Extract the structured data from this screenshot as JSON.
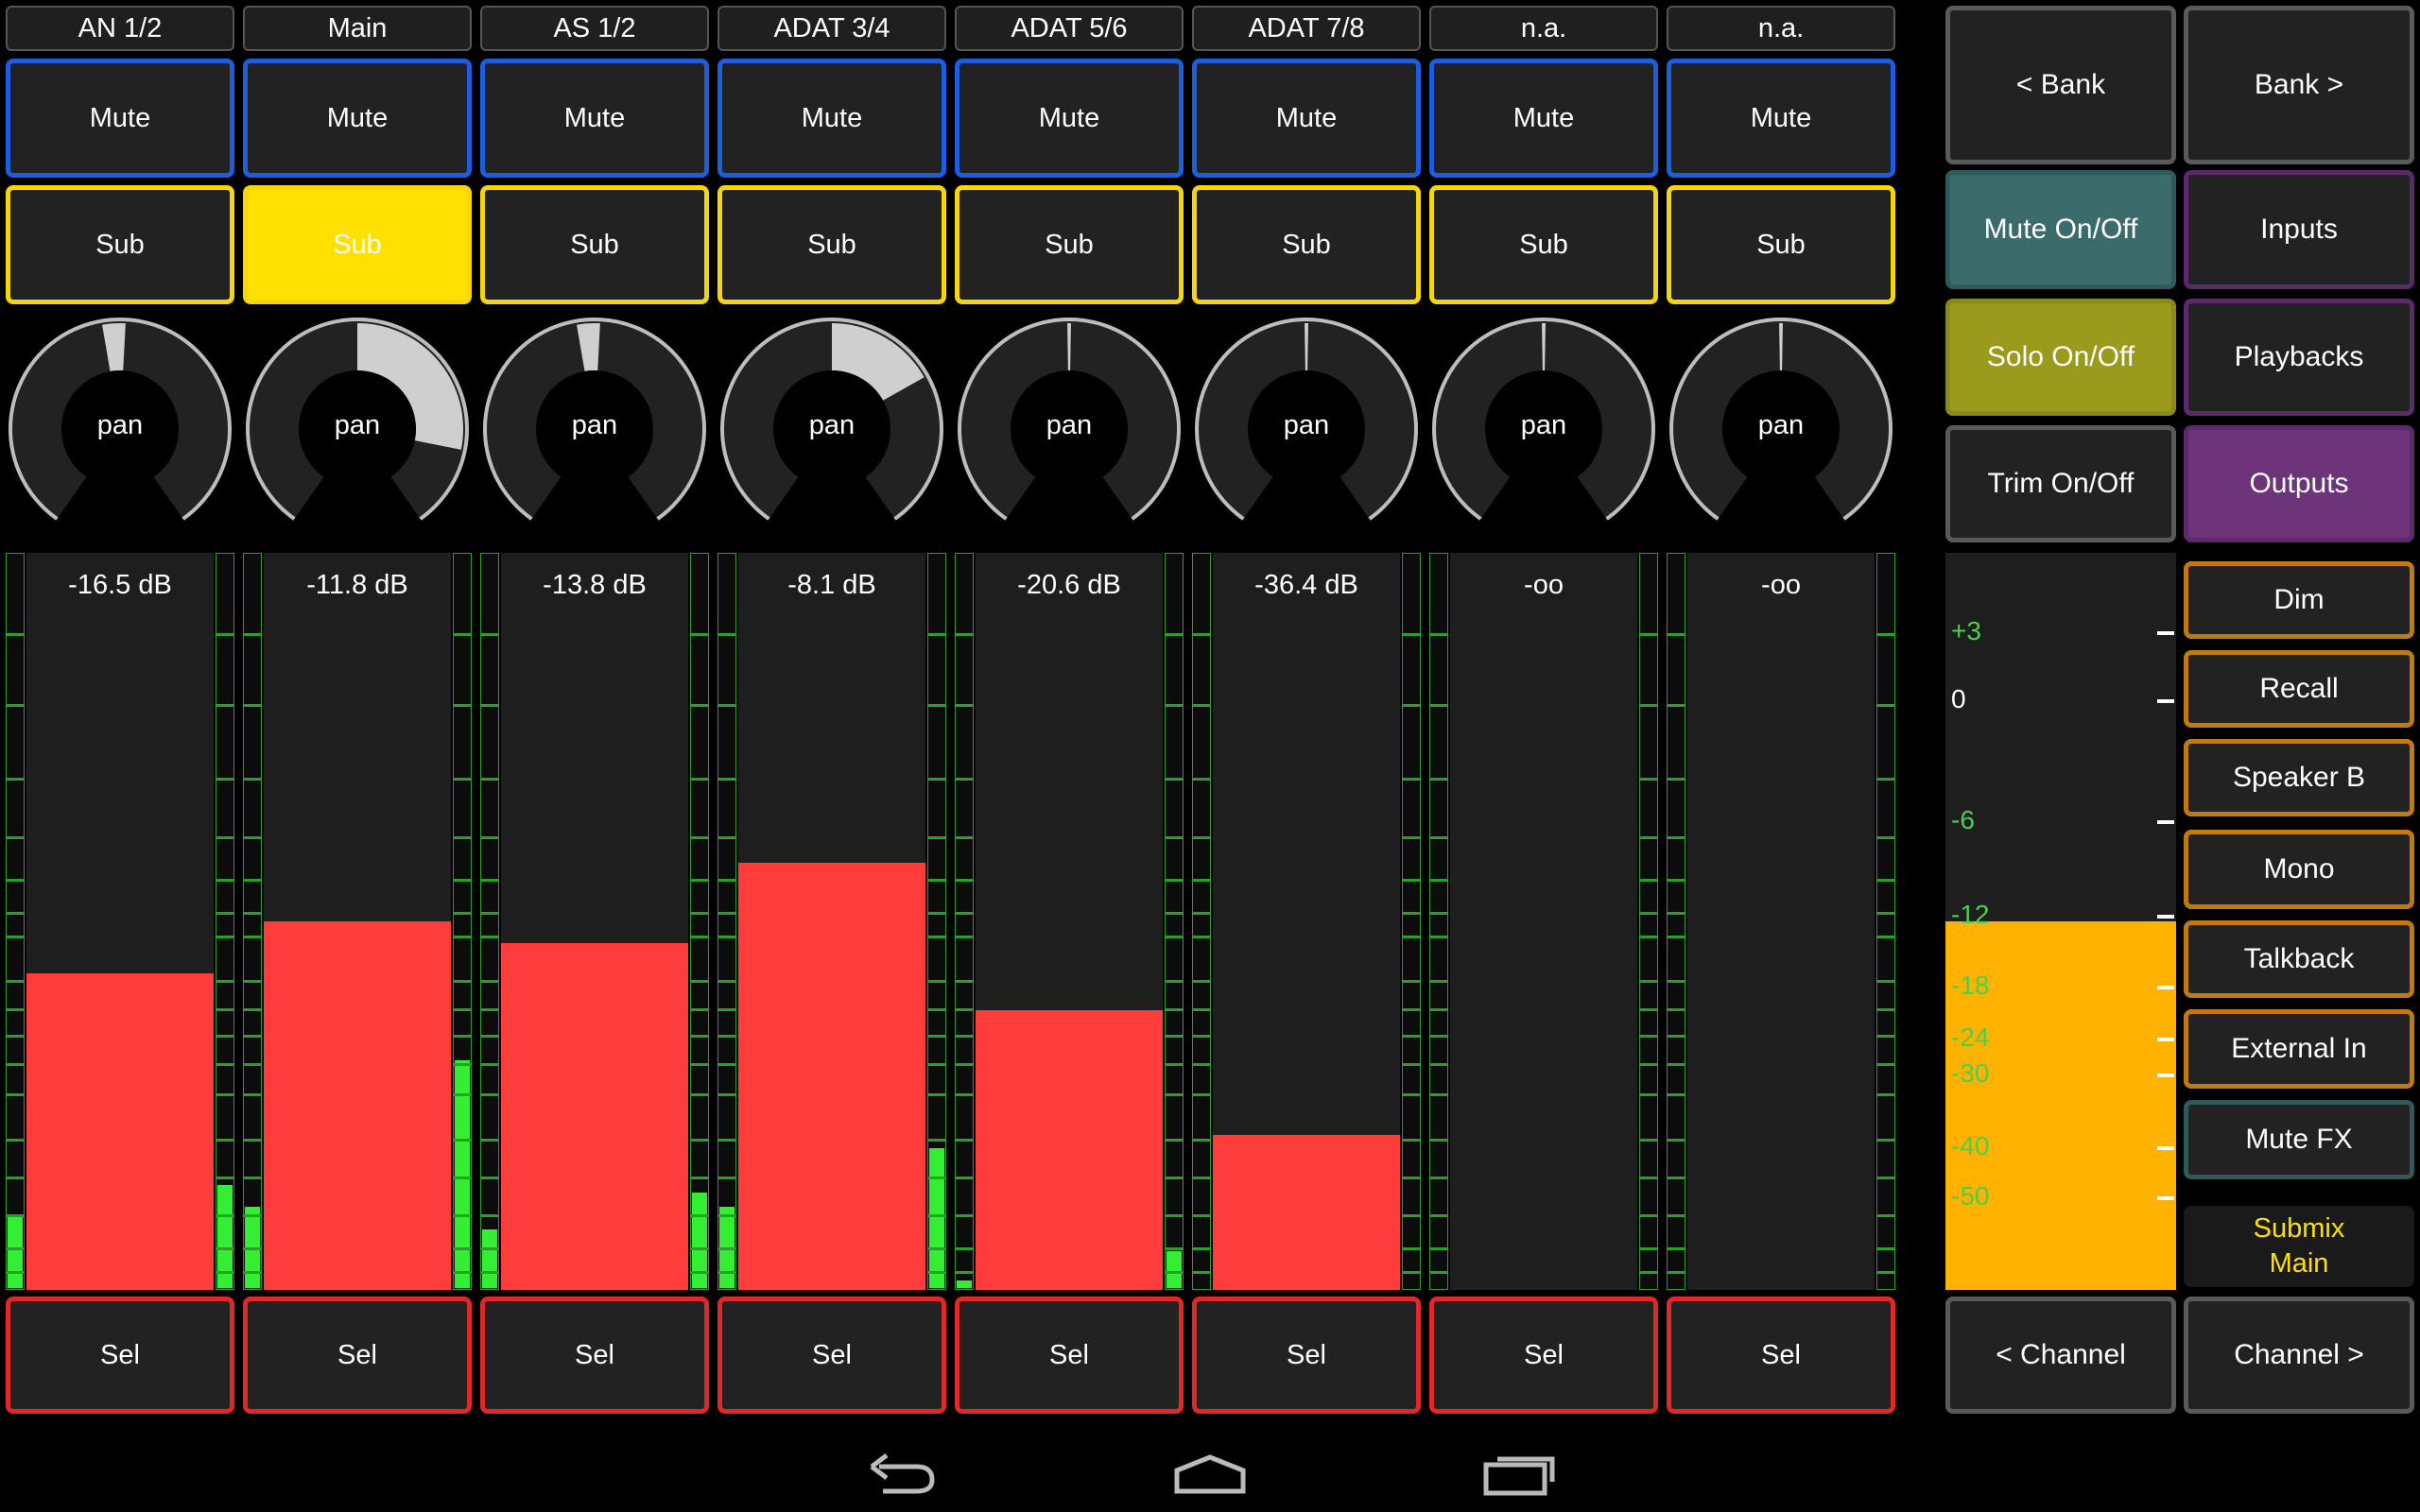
{
  "channels": [
    {
      "name": "AN 1/2",
      "mute": "Mute",
      "sub": "Sub",
      "sub_on": false,
      "pan_label": "pan",
      "pan": -0.05,
      "db": "-16.5 dB",
      "fader": 0.43,
      "lvl_l": 0.1,
      "lvl_r": 0.14,
      "sel": "Sel"
    },
    {
      "name": "Main",
      "mute": "Mute",
      "sub": "Sub",
      "sub_on": true,
      "pan_label": "pan",
      "pan": 0.75,
      "db": "-11.8 dB",
      "fader": 0.5,
      "lvl_l": 0.11,
      "lvl_r": 0.31,
      "sel": "Sel"
    },
    {
      "name": "AS 1/2",
      "mute": "Mute",
      "sub": "Sub",
      "sub_on": false,
      "pan_label": "pan",
      "pan": -0.05,
      "db": "-13.8 dB",
      "fader": 0.47,
      "lvl_l": 0.08,
      "lvl_r": 0.13,
      "sel": "Sel"
    },
    {
      "name": "ADAT 3/4",
      "mute": "Mute",
      "sub": "Sub",
      "sub_on": false,
      "pan_label": "pan",
      "pan": 0.45,
      "db": "-8.1 dB",
      "fader": 0.58,
      "lvl_l": 0.11,
      "lvl_r": 0.19,
      "sel": "Sel"
    },
    {
      "name": "ADAT 5/6",
      "mute": "Mute",
      "sub": "Sub",
      "sub_on": false,
      "pan_label": "pan",
      "pan": 0,
      "db": "-20.6 dB",
      "fader": 0.38,
      "lvl_l": 0.01,
      "lvl_r": 0.05,
      "sel": "Sel"
    },
    {
      "name": "ADAT 7/8",
      "mute": "Mute",
      "sub": "Sub",
      "sub_on": false,
      "pan_label": "pan",
      "pan": 0,
      "db": "-36.4 dB",
      "fader": 0.21,
      "lvl_l": 0,
      "lvl_r": 0,
      "sel": "Sel"
    },
    {
      "name": "n.a.",
      "mute": "Mute",
      "sub": "Sub",
      "sub_on": false,
      "pan_label": "pan",
      "pan": 0,
      "db": "-oo",
      "fader": 0,
      "lvl_l": 0,
      "lvl_r": 0,
      "sel": "Sel"
    },
    {
      "name": "n.a.",
      "mute": "Mute",
      "sub": "Sub",
      "sub_on": false,
      "pan_label": "pan",
      "pan": 0,
      "db": "-oo",
      "fader": 0,
      "lvl_l": 0,
      "lvl_r": 0,
      "sel": "Sel"
    }
  ],
  "right": {
    "bank_prev": "< Bank",
    "bank_next": "Bank >",
    "mute_onoff": "Mute On/Off",
    "inputs": "Inputs",
    "solo_onoff": "Solo On/Off",
    "playbacks": "Playbacks",
    "trim_onoff": "Trim On/Off",
    "outputs": "Outputs",
    "dim": "Dim",
    "recall": "Recall",
    "speaker_b": "Speaker B",
    "mono": "Mono",
    "talkback": "Talkback",
    "external_in": "External In",
    "mute_fx": "Mute FX",
    "submix_line1": "Submix",
    "submix_line2": "Main",
    "channel_prev": "< Channel",
    "channel_next": "Channel >",
    "main_level": 0.5,
    "scale": [
      {
        "label": "+3",
        "green": true
      },
      {
        "label": "0",
        "green": false
      },
      {
        "label": "-6",
        "green": true
      },
      {
        "label": "-12",
        "green": true
      },
      {
        "label": "-18",
        "green": true
      },
      {
        "label": "-24",
        "green": true
      },
      {
        "label": "-30",
        "green": true
      },
      {
        "label": "-40",
        "green": true
      },
      {
        "label": "-50",
        "green": true
      }
    ]
  },
  "colors": {
    "fader": "#ff3c3c",
    "meter": "#33ee33",
    "main_fader": "#ffb300",
    "sub_on": "#ffe000"
  },
  "navbar": {
    "back": "back-icon",
    "home": "home-icon",
    "recents": "recents-icon"
  }
}
